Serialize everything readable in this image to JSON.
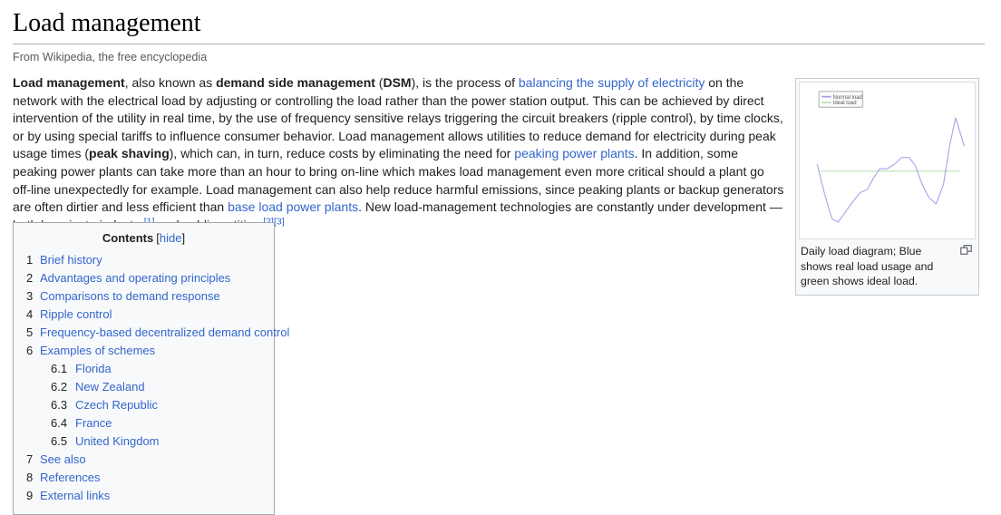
{
  "header": {
    "title": "Load management",
    "tagline": "From Wikipedia, the free encyclopedia"
  },
  "lead": {
    "t1": "Load management",
    "t2": ", also known as ",
    "t3": "demand side management",
    "t4": " (",
    "t5": "DSM",
    "t6": "), is the process of ",
    "link1": "balancing the supply of electricity",
    "t7": " on the network with the electrical load by adjusting or controlling the load rather than the power station output. This can be achieved by direct intervention of the utility in real time, by the use of frequency sensitive relays triggering the circuit breakers (ripple control), by time clocks, or by using special tariffs to influence consumer behavior. Load management allows utilities to reduce demand for electricity during peak usage times (",
    "t8": "peak shaving",
    "t9": "), which can, in turn, reduce costs by eliminating the need for ",
    "link2": "peaking power plants",
    "t10": ". In addition, some peaking power plants can take more than an hour to bring on-line which makes load management even more critical should a plant go off-line unexpectedly for example. Load management can also help reduce harmful emissions, since peaking plants or backup generators are often dirtier and less efficient than ",
    "link3": "base load power plants",
    "t11": ". New load-management technologies are constantly under development — both by private industry",
    "ref1": "[1]",
    "t12": " and public entities.",
    "ref2": "[2]",
    "ref3": "[3]"
  },
  "toc": {
    "title": "Contents",
    "toggle_open": "[",
    "toggle_label": "hide",
    "toggle_close": "]",
    "items": [
      {
        "num": "1",
        "label": "Brief history",
        "sub": false
      },
      {
        "num": "2",
        "label": "Advantages and operating principles",
        "sub": false
      },
      {
        "num": "3",
        "label": "Comparisons to demand response",
        "sub": false
      },
      {
        "num": "4",
        "label": "Ripple control",
        "sub": false
      },
      {
        "num": "5",
        "label": "Frequency-based decentralized demand control",
        "sub": false
      },
      {
        "num": "6",
        "label": "Examples of schemes",
        "sub": false
      },
      {
        "num": "6.1",
        "label": "Florida",
        "sub": true
      },
      {
        "num": "6.2",
        "label": "New Zealand",
        "sub": true
      },
      {
        "num": "6.3",
        "label": "Czech Republic",
        "sub": true
      },
      {
        "num": "6.4",
        "label": "France",
        "sub": true
      },
      {
        "num": "6.5",
        "label": "United Kingdom",
        "sub": true
      },
      {
        "num": "7",
        "label": "See also",
        "sub": false
      },
      {
        "num": "8",
        "label": "References",
        "sub": false
      },
      {
        "num": "9",
        "label": "External links",
        "sub": false
      }
    ]
  },
  "thumbnail": {
    "caption": "Daily load diagram; Blue shows real load usage and green shows ideal load.",
    "magnify_icon": "enlarge-icon"
  },
  "chart_data": {
    "type": "line",
    "title": "",
    "xlabel": "",
    "ylabel": "",
    "xlim": [
      0,
      24
    ],
    "ylim": [
      0,
      1
    ],
    "grid": false,
    "legend_position": "top-left",
    "series": [
      {
        "name": "Normal load",
        "color": "#a9a0e8",
        "x": [
          0,
          1.2,
          2.4,
          3.4,
          4.6,
          5.8,
          7.0,
          8.2,
          9.2,
          10.2,
          11.4,
          12.6,
          13.8,
          15.0,
          16.0,
          17.0,
          18.2,
          19.4,
          20.6,
          21.6,
          22.6,
          24
        ],
        "values": [
          0.56,
          0.3,
          0.08,
          0.05,
          0.14,
          0.23,
          0.31,
          0.34,
          0.44,
          0.52,
          0.52,
          0.56,
          0.62,
          0.62,
          0.55,
          0.4,
          0.27,
          0.21,
          0.38,
          0.72,
          0.97,
          0.72
        ]
      },
      {
        "name": "Ideal load",
        "color": "#b8e0b8",
        "x": [
          0.6,
          23.4
        ],
        "values": [
          0.5,
          0.5
        ]
      }
    ]
  },
  "colors": {
    "link": "#3366cc",
    "text": "#202122",
    "rule": "#a2a9b1",
    "toc_bg": "#f8f9fa",
    "toc_border": "#a2a9b1",
    "thumb_border": "#c8ccd1",
    "normal_load": "#a9a0e8",
    "ideal_load": "#b8e0b8"
  }
}
